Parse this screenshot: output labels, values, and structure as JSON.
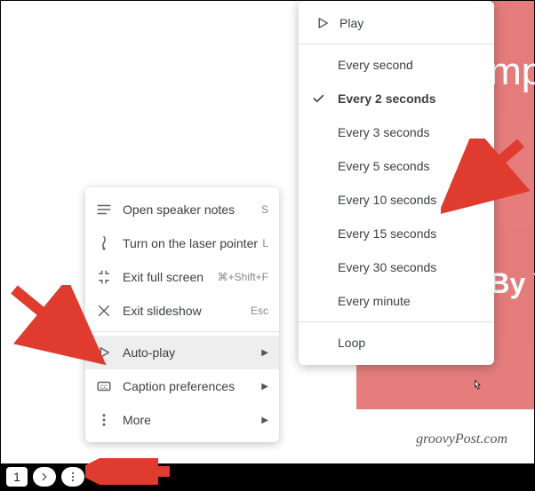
{
  "backdrop": {
    "title": "Simpl",
    "subtitle": "By Y"
  },
  "watermark": "groovyPost.com",
  "bottombar": {
    "slide": "1"
  },
  "menu": {
    "speaker": {
      "label": "Open speaker notes",
      "key": "S"
    },
    "laser": {
      "label": "Turn on the laser pointer",
      "key": "L"
    },
    "exitfull": {
      "label": "Exit full screen",
      "key": "⌘+Shift+F"
    },
    "exitshow": {
      "label": "Exit slideshow",
      "key": "Esc"
    },
    "autoplay": {
      "label": "Auto-play"
    },
    "captions": {
      "label": "Caption preferences"
    },
    "more": {
      "label": "More"
    }
  },
  "submenu": {
    "play": "Play",
    "e1": "Every second",
    "e2": "Every 2 seconds",
    "e3": "Every 3 seconds",
    "e5": "Every 5 seconds",
    "e10": "Every 10 seconds",
    "e15": "Every 15 seconds",
    "e30": "Every 30 seconds",
    "emin": "Every minute",
    "loop": "Loop"
  }
}
